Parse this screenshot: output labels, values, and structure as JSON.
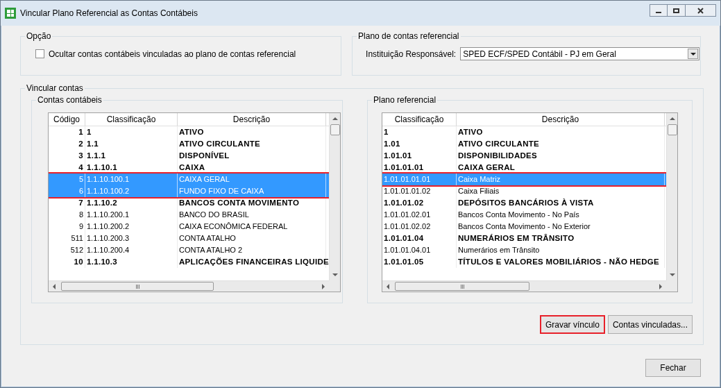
{
  "window": {
    "title": "Vincular Plano Referencial as Contas Contábeis"
  },
  "option_group": {
    "title": "Opção",
    "checkbox": {
      "label": "Ocultar contas contábeis vinculadas ao plano de contas referencial",
      "checked": false
    }
  },
  "reference_group": {
    "title": "Plano de contas referencial",
    "field_label": "Instituição Responsável:",
    "dropdown_value": "SPED ECF/SPED Contábil - PJ em Geral"
  },
  "link_group": {
    "title": "Vincular contas",
    "accounts": {
      "title": "Contas contábeis",
      "columns": [
        "Código",
        "Classificação",
        "Descrição"
      ],
      "rows": [
        {
          "kind": "group",
          "selected": false,
          "cells": [
            "1",
            "1",
            "ATIVO"
          ]
        },
        {
          "kind": "group",
          "selected": false,
          "cells": [
            "2",
            "1.1",
            "ATIVO CIRCULANTE"
          ]
        },
        {
          "kind": "group",
          "selected": false,
          "cells": [
            "3",
            "1.1.1",
            "DISPONÍVEL"
          ]
        },
        {
          "kind": "group",
          "selected": false,
          "cells": [
            "4",
            "1.1.10.1",
            "CAIXA"
          ]
        },
        {
          "kind": "account",
          "selected": true,
          "cells": [
            "5",
            "1.1.10.100.1",
            "CAIXA GERAL"
          ]
        },
        {
          "kind": "account",
          "selected": true,
          "cells": [
            "6",
            "1.1.10.100.2",
            "FUNDO FIXO DE CAIXA"
          ]
        },
        {
          "kind": "group",
          "selected": false,
          "cells": [
            "7",
            "1.1.10.2",
            "BANCOS CONTA MOVIMENTO"
          ]
        },
        {
          "kind": "account",
          "selected": false,
          "cells": [
            "8",
            "1.1.10.200.1",
            "BANCO DO BRASIL"
          ]
        },
        {
          "kind": "account",
          "selected": false,
          "cells": [
            "9",
            "1.1.10.200.2",
            "CAIXA ECONÔMICA FEDERAL"
          ]
        },
        {
          "kind": "account",
          "selected": false,
          "cells": [
            "511",
            "1.1.10.200.3",
            "CONTA ATALHO"
          ]
        },
        {
          "kind": "account",
          "selected": false,
          "cells": [
            "512",
            "1.1.10.200.4",
            "CONTA ATALHO 2"
          ]
        },
        {
          "kind": "group",
          "selected": false,
          "cells": [
            "10",
            "1.1.10.3",
            "APLICAÇÕES FINANCEIRAS LIQUIDE"
          ]
        }
      ]
    },
    "reference": {
      "title": "Plano referencial",
      "columns": [
        "Classificação",
        "Descrição"
      ],
      "rows": [
        {
          "kind": "group",
          "selected": false,
          "cells": [
            "1",
            "ATIVO"
          ]
        },
        {
          "kind": "group",
          "selected": false,
          "cells": [
            "1.01",
            "ATIVO CIRCULANTE"
          ]
        },
        {
          "kind": "group",
          "selected": false,
          "cells": [
            "1.01.01",
            "DISPONIBILIDADES"
          ]
        },
        {
          "kind": "group",
          "selected": false,
          "cells": [
            "1.01.01.01",
            "CAIXA GERAL"
          ]
        },
        {
          "kind": "account",
          "selected": true,
          "cells": [
            "1.01.01.01.01",
            "Caixa Matriz"
          ]
        },
        {
          "kind": "account",
          "selected": false,
          "cells": [
            "1.01.01.01.02",
            "Caixa Filiais"
          ]
        },
        {
          "kind": "group",
          "selected": false,
          "cells": [
            "1.01.01.02",
            "DEPÓSITOS BANCÁRIOS À VISTA"
          ]
        },
        {
          "kind": "account",
          "selected": false,
          "cells": [
            "1.01.01.02.01",
            "Bancos Conta Movimento - No País"
          ]
        },
        {
          "kind": "account",
          "selected": false,
          "cells": [
            "1.01.01.02.02",
            "Bancos Conta Movimento - No Exterior"
          ]
        },
        {
          "kind": "group",
          "selected": false,
          "cells": [
            "1.01.01.04",
            "NUMERÁRIOS EM TRÂNSITO"
          ]
        },
        {
          "kind": "account",
          "selected": false,
          "cells": [
            "1.01.01.04.01",
            "Numerários em Trânsito"
          ]
        },
        {
          "kind": "group",
          "selected": false,
          "cells": [
            "1.01.01.05",
            "TÍTULOS E VALORES MOBILIÁRIOS - NÃO HEDGE"
          ]
        }
      ]
    },
    "buttons": [
      {
        "label": "Gravar vínculo",
        "highlighted": true
      },
      {
        "label": "Contas vinculadas...",
        "highlighted": false
      }
    ]
  },
  "footer_button": "Fechar"
}
